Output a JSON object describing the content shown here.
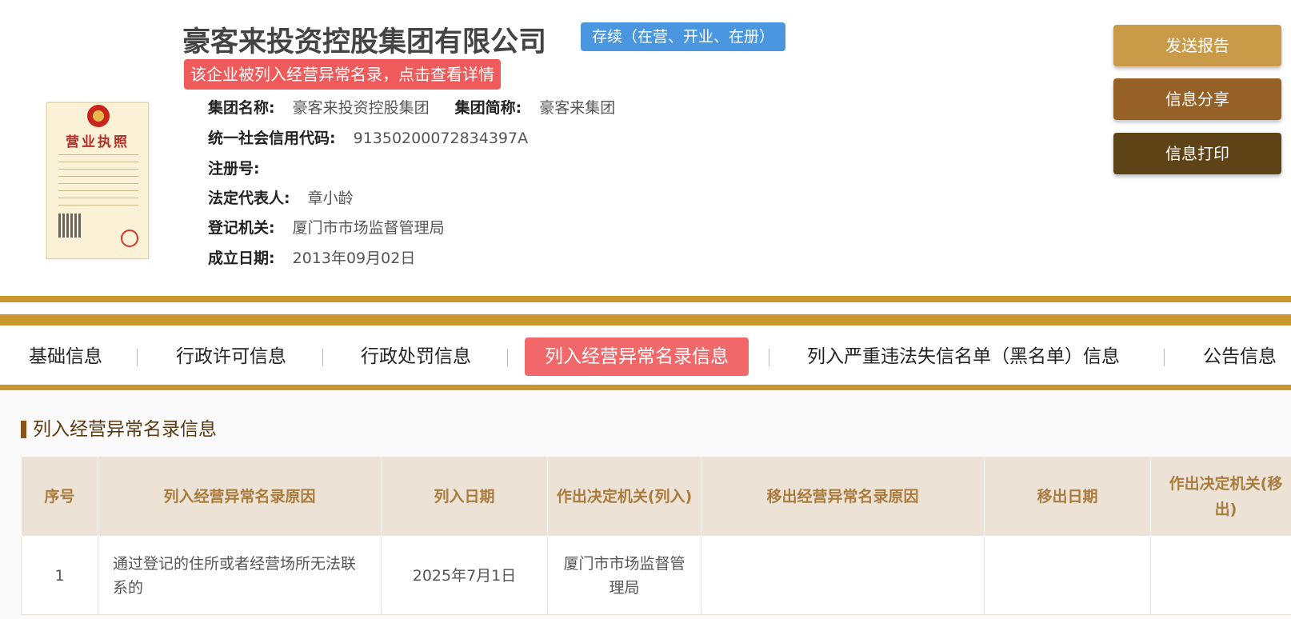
{
  "company": {
    "name": "豪客来投资控股集团有限公司",
    "status": "存续（在营、开业、在册）",
    "alert": "该企业被列入经营异常名录，点击查看详情",
    "license_title": "营业执照"
  },
  "info": {
    "group_name_label": "集团名称:",
    "group_name": "豪客来投资控股集团",
    "group_short_label": "集团简称:",
    "group_short": "豪客来集团",
    "credit_code_label": "统一社会信用代码:",
    "credit_code": "91350200072834397A",
    "reg_no_label": "注册号:",
    "legal_rep_label": "法定代表人:",
    "legal_rep": "章小龄",
    "reg_authority_label": "登记机关:",
    "reg_authority": "厦门市市场监督管理局",
    "founded_label": "成立日期:",
    "founded": "2013年09月02日"
  },
  "actions": {
    "send_report": "发送报告",
    "share": "信息分享",
    "print": "信息打印"
  },
  "tabs": [
    {
      "label": "基础信息"
    },
    {
      "label": "行政许可信息"
    },
    {
      "label": "行政处罚信息"
    },
    {
      "label": "列入经营异常名录信息"
    },
    {
      "label": "列入严重违法失信名单（黑名单）信息"
    },
    {
      "label": "公告信息"
    }
  ],
  "active_tab": "列入经营异常名录信息",
  "section": {
    "title": "列入经营异常名录信息",
    "columns": [
      "序号",
      "列入经营异常名录原因",
      "列入日期",
      "作出决定机关(列入)",
      "移出经营异常名录原因",
      "移出日期",
      "作出决定机关(移出)"
    ],
    "rows": [
      {
        "index": "1",
        "reason": "通过登记的住所或者经营场所无法联系的",
        "date_in": "2025年7月1日",
        "authority_in": "厦门市市场监督管理局",
        "reason_out": "",
        "date_out": "",
        "authority_out": ""
      }
    ]
  },
  "colors": {
    "gold": "#c9962f",
    "active_tab": "#f0686a",
    "status_blue": "#4a97e0",
    "alert_red": "#ef5b5b",
    "btn_send": "#c99a48",
    "btn_share": "#956127",
    "btn_print": "#5d4316"
  }
}
